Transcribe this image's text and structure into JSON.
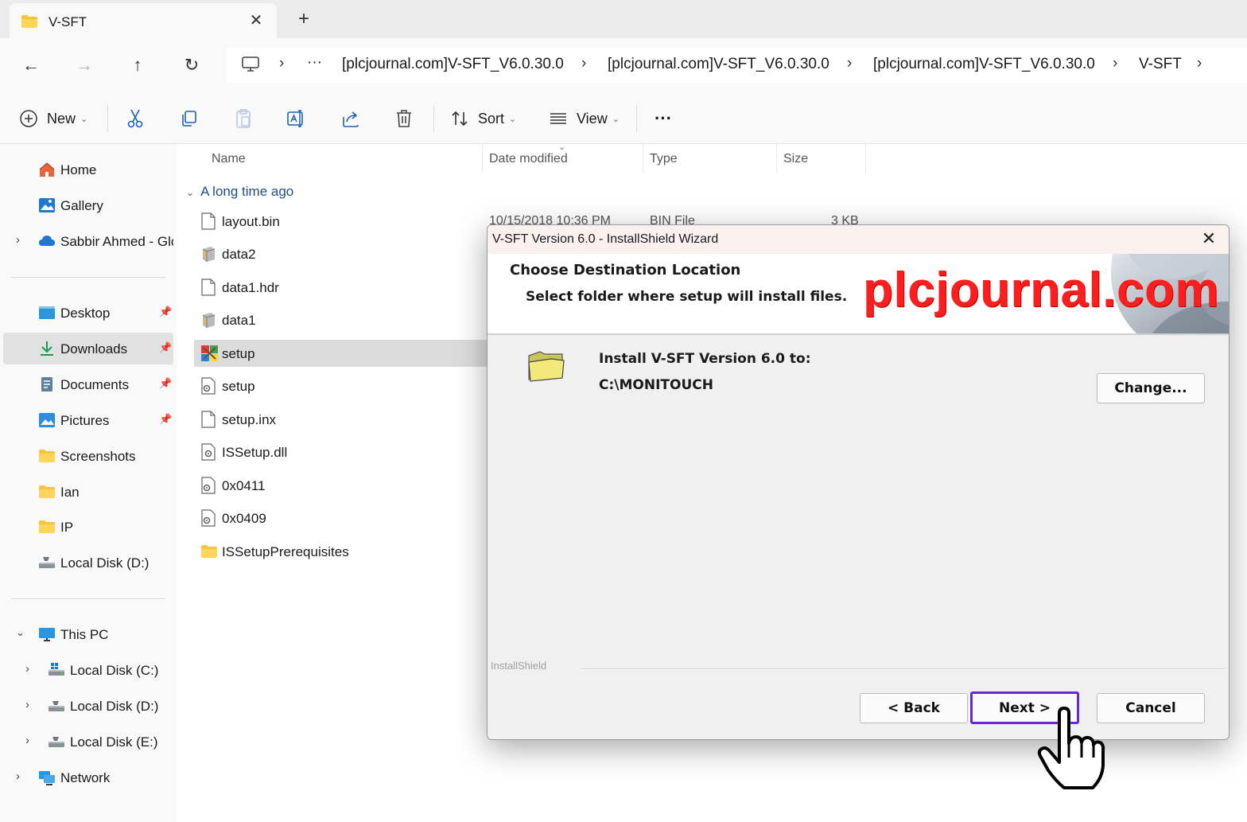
{
  "tab": {
    "title": "V-SFT",
    "close": "✕",
    "new": "+"
  },
  "nav_buttons": {
    "back": "←",
    "forward": "→",
    "up": "↑",
    "refresh": "↻"
  },
  "address": {
    "more": "···",
    "crumbs": [
      "[plcjournal.com]V-SFT_V6.0.30.0",
      "[plcjournal.com]V-SFT_V6.0.30.0",
      "[plcjournal.com]V-SFT_V6.0.30.0",
      "V-SFT"
    ],
    "separator": "›"
  },
  "toolbar": {
    "new": "New",
    "sort": "Sort",
    "view": "View",
    "more": "···"
  },
  "sidebar": {
    "home": "Home",
    "gallery": "Gallery",
    "onedrive": "Sabbir Ahmed - Glo",
    "desktop": "Desktop",
    "downloads": "Downloads",
    "documents": "Documents",
    "pictures": "Pictures",
    "screenshots": "Screenshots",
    "ian": "Ian",
    "ip": "IP",
    "local_d_quick": "Local Disk (D:)",
    "this_pc": "This PC",
    "local_c": "Local Disk (C:)",
    "local_d": "Local Disk (D:)",
    "local_e": "Local Disk (E:)",
    "network": "Network"
  },
  "columns": {
    "name": "Name",
    "date": "Date modified",
    "type": "Type",
    "size": "Size"
  },
  "group_label": "A long time ago",
  "files": [
    "layout.bin",
    "data2",
    "data1.hdr",
    "data1",
    "setup",
    "setup",
    "setup.inx",
    "ISSetup.dll",
    "0x0411",
    "0x0409",
    "ISSetupPrerequisites"
  ],
  "peek_row": {
    "date": "10/15/2018 10:36 PM",
    "type": "BIN File",
    "size": "3 KB"
  },
  "dialog": {
    "title": "V-SFT Version 6.0 - InstallShield Wizard",
    "close": "✕",
    "heading": "Choose Destination Location",
    "subheading": "Select folder where setup will install files.",
    "watermark": "plcjournal.com",
    "install_label": "Install V-SFT Version 6.0 to:",
    "install_path": "C:\\MONITOUCH",
    "change_button": "Change...",
    "brand": "InstallShield",
    "back_button": "< Back",
    "next_button": "Next >",
    "cancel_button": "Cancel"
  },
  "colors": {
    "accent": "#0067c0",
    "highlight_box": "#6a27d8",
    "watermark": "#ff1e1e"
  }
}
